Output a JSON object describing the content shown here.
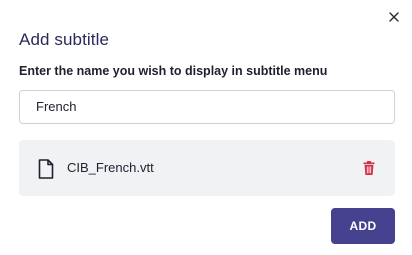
{
  "dialog": {
    "title": "Add subtitle",
    "name_label": "Enter the name you wish to display in subtitle menu",
    "name_value": "French",
    "file": {
      "name": "CIB_French.vtt",
      "icon": "file-icon"
    },
    "add_label": "ADD",
    "close_icon": "close-icon",
    "delete_icon": "trash-icon"
  },
  "colors": {
    "title": "#2a2a5a",
    "accent": "#45418f",
    "delete": "#d32f4a",
    "file_row_bg": "#f1f2f4"
  }
}
